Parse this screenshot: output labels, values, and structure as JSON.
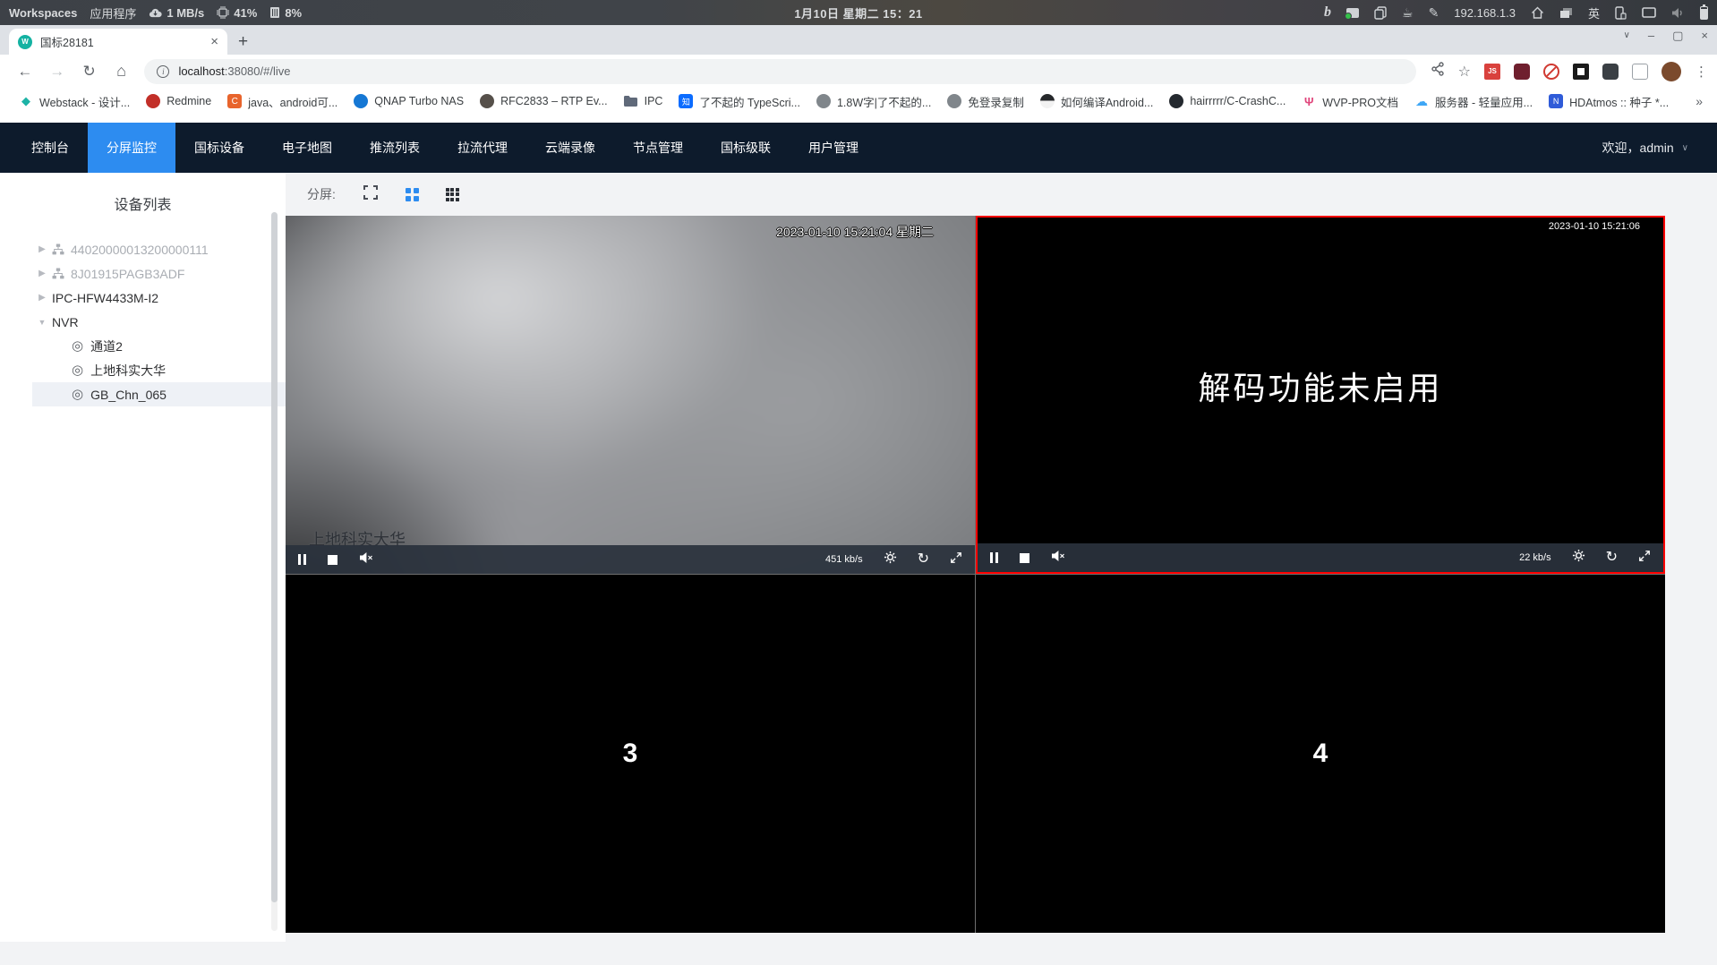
{
  "system_bar": {
    "workspaces_label": "Workspaces",
    "applications_label": "应用程序",
    "network_speed": "1 MB/s",
    "cpu_usage": "41%",
    "memory_usage": "8%",
    "clock": "1月10日 星期二 15：21",
    "ip_address": "192.168.1.3",
    "input_method": "英"
  },
  "browser": {
    "tab_title": "国标28181",
    "url_host": "localhost",
    "url_rest": ":38080/#/live",
    "ext_js_label": "JS",
    "overflow_chevron": "»",
    "bookmarks": [
      {
        "label": "Webstack - 设计...",
        "icon_char": "◆"
      },
      {
        "label": "Redmine",
        "icon_char": ""
      },
      {
        "label": "java、android可...",
        "icon_char": "C"
      },
      {
        "label": "QNAP Turbo NAS",
        "icon_char": ""
      },
      {
        "label": "RFC2833 – RTP Ev...",
        "icon_char": ""
      },
      {
        "label": "IPC",
        "icon_char": ""
      },
      {
        "label": "了不起的 TypeScri...",
        "icon_char": "知"
      },
      {
        "label": "1.8W字|了不起的...",
        "icon_char": ""
      },
      {
        "label": "免登录复制",
        "icon_char": ""
      },
      {
        "label": "如何编译Android...",
        "icon_char": ""
      },
      {
        "label": "hairrrrr/C-CrashC...",
        "icon_char": ""
      },
      {
        "label": "WVP-PRO文档",
        "icon_char": "Ψ"
      },
      {
        "label": "服务器 - 轻量应用...",
        "icon_char": "☁"
      },
      {
        "label": "HDAtmos :: 种子 *...",
        "icon_char": "N"
      }
    ]
  },
  "nav": {
    "items": [
      {
        "label": "控制台"
      },
      {
        "label": "分屏监控"
      },
      {
        "label": "国标设备"
      },
      {
        "label": "电子地图"
      },
      {
        "label": "推流列表"
      },
      {
        "label": "拉流代理"
      },
      {
        "label": "云端录像"
      },
      {
        "label": "节点管理"
      },
      {
        "label": "国标级联"
      },
      {
        "label": "用户管理"
      }
    ],
    "welcome": "欢迎，admin"
  },
  "sidebar": {
    "title": "设备列表",
    "tree": [
      {
        "label": "44020000013200000111"
      },
      {
        "label": "8J01915PAGB3ADF"
      },
      {
        "label": "IPC-HFW4433M-I2"
      },
      {
        "label": "NVR"
      },
      {
        "label": "通道2"
      },
      {
        "label": "上地科实大华"
      },
      {
        "label": "GB_Chn_065"
      }
    ]
  },
  "screen_toolbar": {
    "label": "分屏:"
  },
  "video_grid": {
    "cell1": {
      "timestamp": "2023-01-10 15:21:04 星期二",
      "overlay_name": "上地科实大华",
      "bitrate": "451 kb/s"
    },
    "cell2": {
      "timestamp": "2023-01-10 15:21:06",
      "message": "解码功能未启用",
      "bitrate": "22 kb/s"
    },
    "cell3": {
      "number": "3"
    },
    "cell4": {
      "number": "4"
    }
  },
  "icons": {
    "caret_right": "▶",
    "caret_down": "▼",
    "camera": "◎",
    "back": "←",
    "forward": "→",
    "reload": "↻",
    "star": "☆",
    "menu_dots": "⋮",
    "close": "×",
    "new_tab": "+",
    "chevron_down": "∨",
    "win_min": "–",
    "win_restore": "▢",
    "bing": "b",
    "coffee": "☕",
    "pen": "✎",
    "favicon_char": "W"
  },
  "colors": {
    "accent_blue": "#2d8cf0",
    "nav_bg": "#0d1b2c",
    "selected_border": "#ff0000"
  }
}
